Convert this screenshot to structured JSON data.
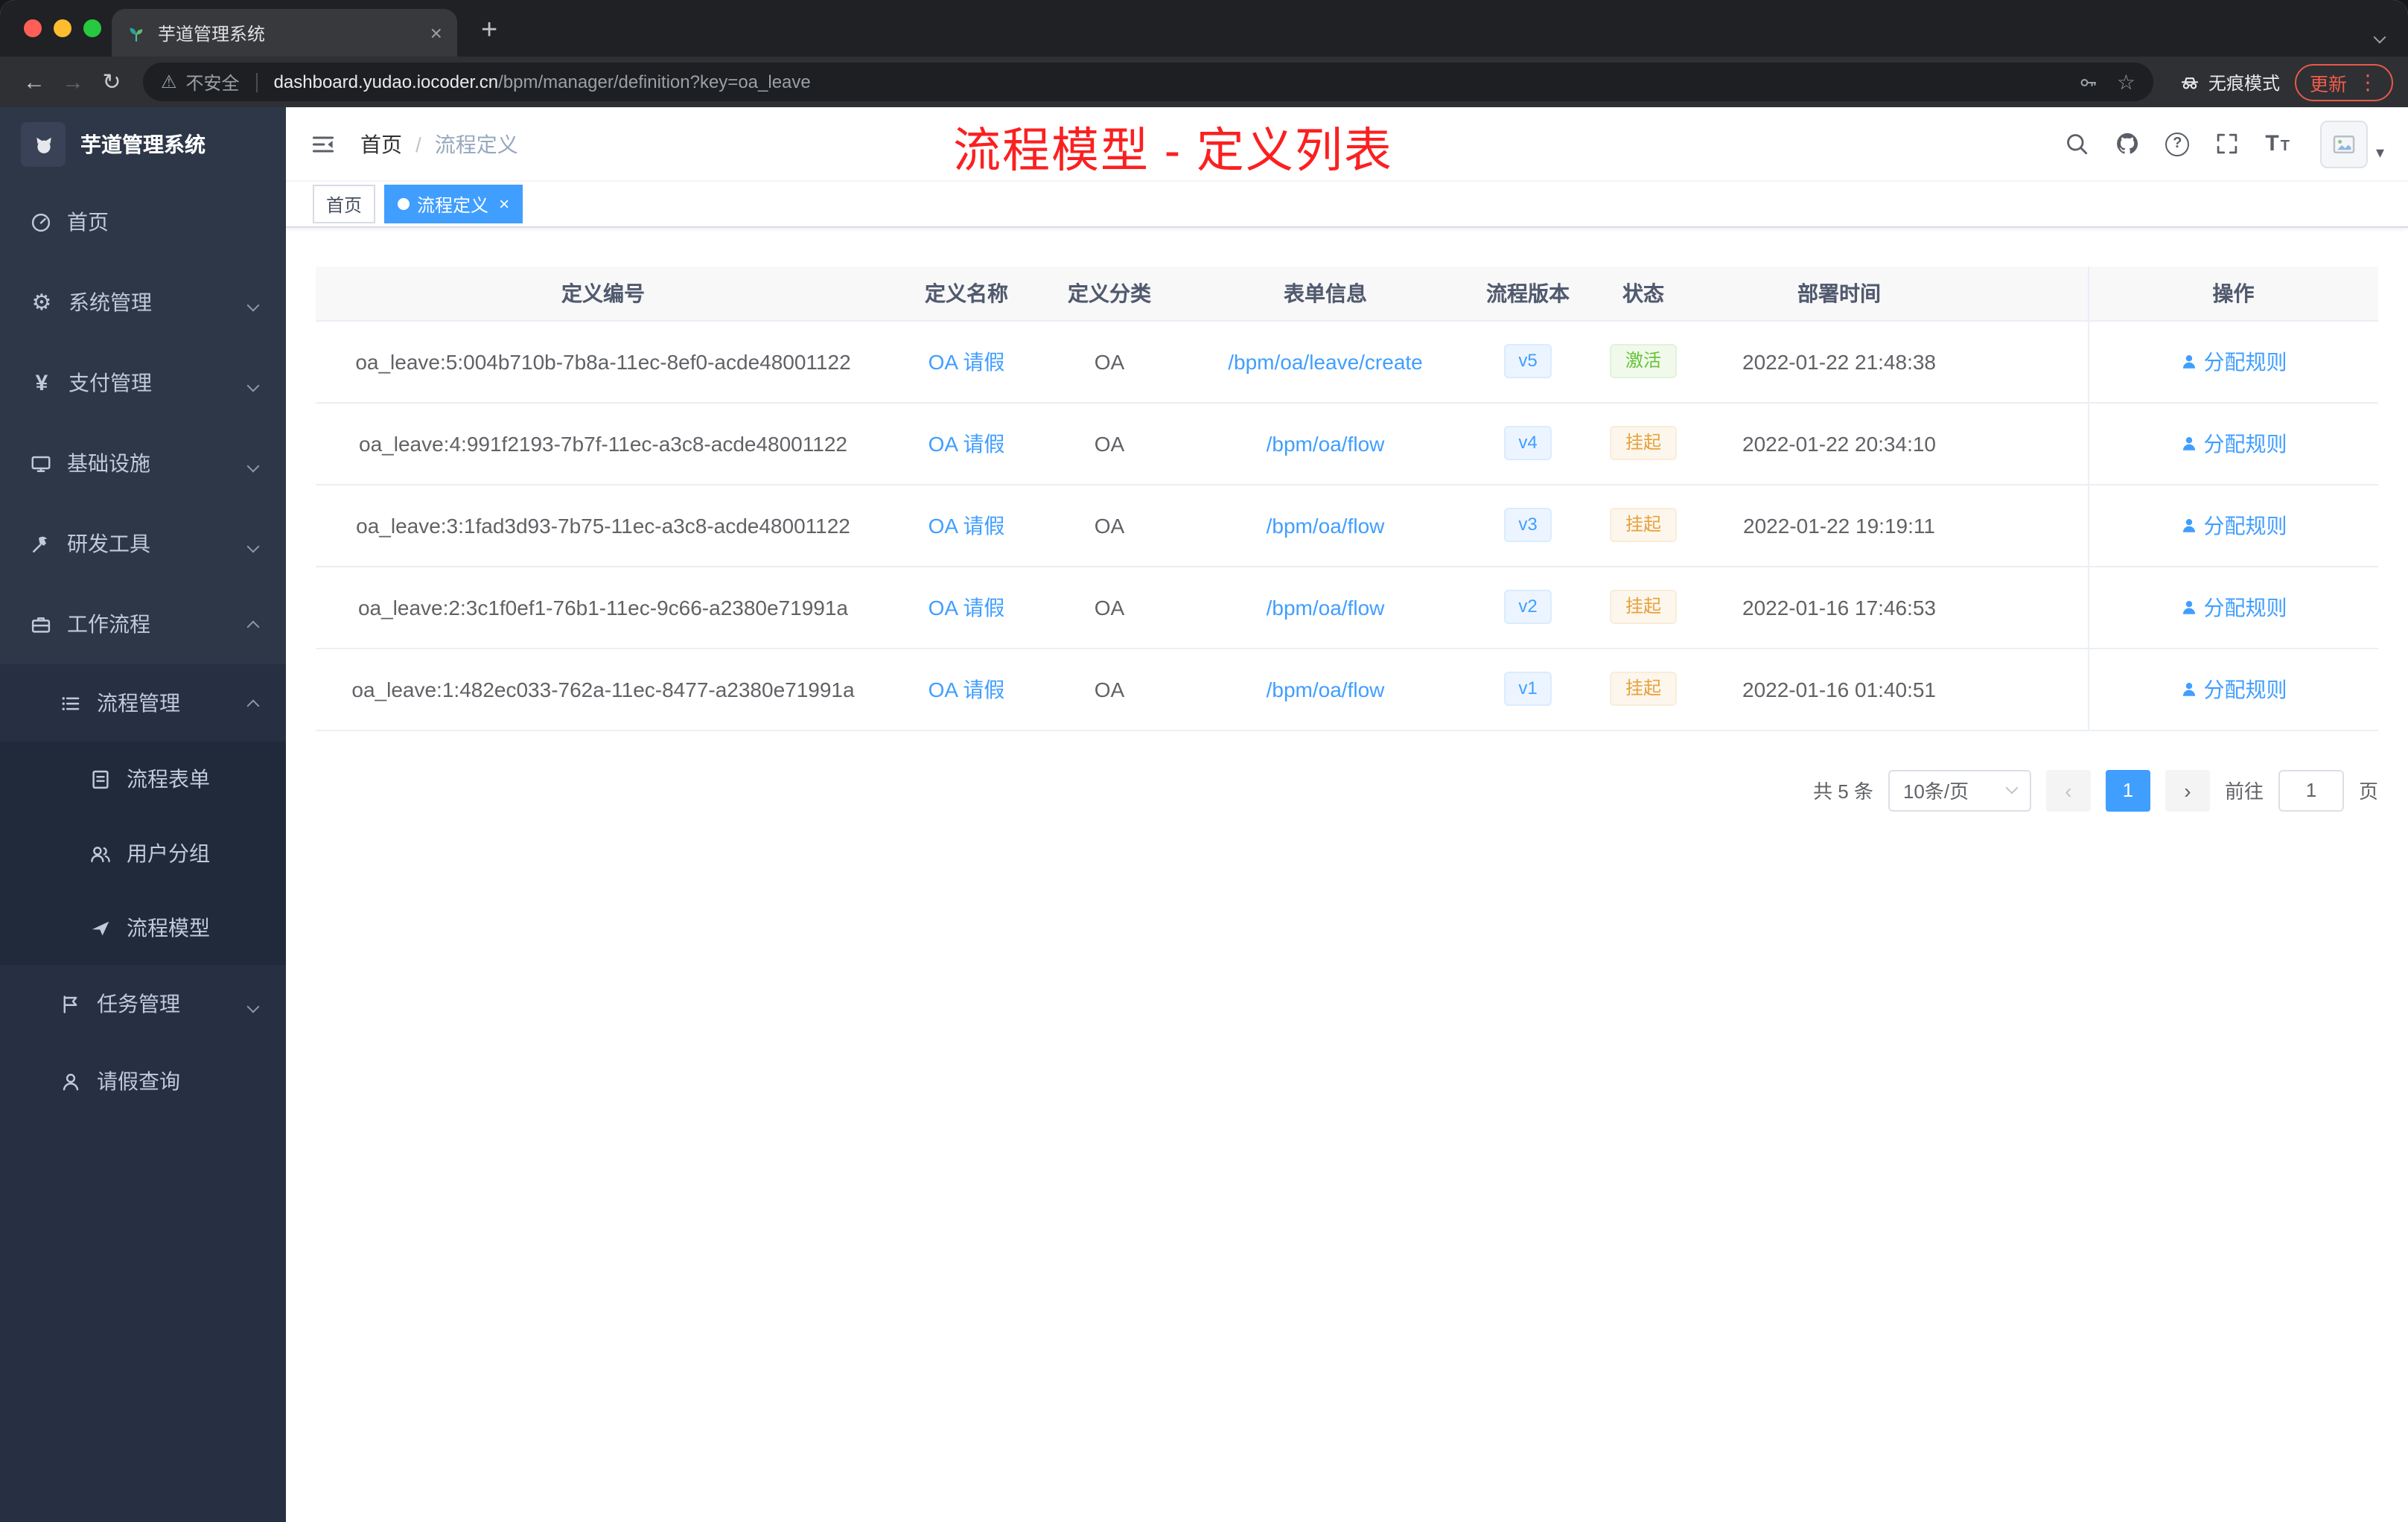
{
  "colors": {
    "accent": "#409eff",
    "annotation_red": "#fb2020",
    "status_active": "#67c23a",
    "status_suspended": "#e6a23c",
    "sidebar_bg": "#2e3748",
    "active_tag_bg": "#409eff"
  },
  "icons": {
    "back": "←",
    "forward": "→",
    "reload": "↻",
    "warning": "⚠",
    "star": "☆",
    "menu_dots": "⋮",
    "gear": "⚙",
    "yen": "¥",
    "new_tab": "+",
    "close": "×",
    "prev": "‹",
    "next": "›",
    "help": "?",
    "caret_down": "▾"
  },
  "browser": {
    "tab_title": "芋道管理系统",
    "security_label": "不安全",
    "url_domain": "dashboard.yudao.iocoder.cn",
    "url_path": "/bpm/manager/definition?key=oa_leave",
    "incognito_label": "无痕模式",
    "update_label": "更新"
  },
  "sidebar": {
    "logo_title": "芋道管理系统",
    "items": {
      "home": "首页",
      "system": "系统管理",
      "payment": "支付管理",
      "infra": "基础设施",
      "devtools": "研发工具",
      "workflow": "工作流程",
      "process_mgmt": "流程管理",
      "process_form": "流程表单",
      "user_group": "用户分组",
      "process_model": "流程模型",
      "task_mgmt": "任务管理",
      "leave_query": "请假查询"
    }
  },
  "header": {
    "breadcrumb_home": "首页",
    "breadcrumb_separator": "/",
    "breadcrumb_current": "流程定义",
    "annotation": "流程模型 - 定义列表"
  },
  "tags": {
    "home": "首页",
    "current": "流程定义"
  },
  "table": {
    "columns": [
      "定义编号",
      "定义名称",
      "定义分类",
      "表单信息",
      "流程版本",
      "状态",
      "部署时间",
      "操作"
    ],
    "rows": [
      {
        "id": "oa_leave:5:004b710b-7b8a-11ec-8ef0-acde48001122",
        "name": "OA 请假",
        "category": "OA",
        "form": "/bpm/oa/leave/create",
        "version": "v5",
        "status": "激活",
        "time": "2022-01-22 21:48:38",
        "action": "分配规则"
      },
      {
        "id": "oa_leave:4:991f2193-7b7f-11ec-a3c8-acde48001122",
        "name": "OA 请假",
        "category": "OA",
        "form": "/bpm/oa/flow",
        "version": "v4",
        "status": "挂起",
        "time": "2022-01-22 20:34:10",
        "action": "分配规则"
      },
      {
        "id": "oa_leave:3:1fad3d93-7b75-11ec-a3c8-acde48001122",
        "name": "OA 请假",
        "category": "OA",
        "form": "/bpm/oa/flow",
        "version": "v3",
        "status": "挂起",
        "time": "2022-01-22 19:19:11",
        "action": "分配规则"
      },
      {
        "id": "oa_leave:2:3c1f0ef1-76b1-11ec-9c66-a2380e71991a",
        "name": "OA 请假",
        "category": "OA",
        "form": "/bpm/oa/flow",
        "version": "v2",
        "status": "挂起",
        "time": "2022-01-16 17:46:53",
        "action": "分配规则"
      },
      {
        "id": "oa_leave:1:482ec033-762a-11ec-8477-a2380e71991a",
        "name": "OA 请假",
        "category": "OA",
        "form": "/bpm/oa/flow",
        "version": "v1",
        "status": "挂起",
        "time": "2022-01-16 01:40:51",
        "action": "分配规则"
      }
    ]
  },
  "pagination": {
    "total": "共 5 条",
    "page_size": "10条/页",
    "page": "1",
    "goto": "前往",
    "unit": "页",
    "goto_value": "1"
  }
}
